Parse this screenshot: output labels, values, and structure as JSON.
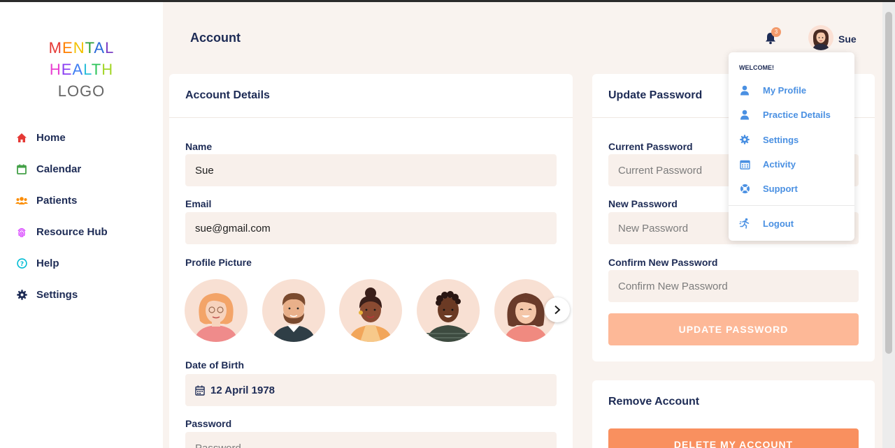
{
  "logo": {
    "line1": "MENTAL",
    "line2": "HEALTH",
    "line3": "LOGO"
  },
  "sidebar": {
    "items": [
      {
        "label": "Home",
        "icon": "home-icon",
        "color": "#e53935"
      },
      {
        "label": "Calendar",
        "icon": "calendar-icon",
        "color": "#43a047"
      },
      {
        "label": "Patients",
        "icon": "users-icon",
        "color": "#fb8c00"
      },
      {
        "label": "Resource Hub",
        "icon": "fingerprint-icon",
        "color": "#d63aff"
      },
      {
        "label": "Help",
        "icon": "help-icon",
        "color": "#00bcd4"
      },
      {
        "label": "Settings",
        "icon": "gear-icon",
        "color": "#1d2b55"
      }
    ]
  },
  "header": {
    "title": "Account",
    "notification_count": "3",
    "user_name": "Sue"
  },
  "account_details": {
    "title": "Account Details",
    "name_label": "Name",
    "name_value": "Sue",
    "email_label": "Email",
    "email_value": "sue@gmail.com",
    "picture_label": "Profile Picture",
    "dob_label": "Date of Birth",
    "dob_value": "12 April 1978",
    "password_label": "Password",
    "password_placeholder": "Password"
  },
  "update_password": {
    "title": "Update Password",
    "current_label": "Current Password",
    "current_placeholder": "Current Password",
    "new_label": "New Password",
    "new_placeholder": "New Password",
    "confirm_label": "Confirm New Password",
    "confirm_placeholder": "Confirm New Password",
    "button": "UPDATE PASSWORD"
  },
  "remove_account": {
    "title": "Remove Account",
    "button": "DELETE MY ACCOUNT"
  },
  "dropdown": {
    "welcome": "WELCOME!",
    "items": [
      {
        "label": "My Profile",
        "icon": "user-icon"
      },
      {
        "label": "Practice Details",
        "icon": "user-icon"
      },
      {
        "label": "Settings",
        "icon": "gear-icon"
      },
      {
        "label": "Activity",
        "icon": "calendar-icon"
      },
      {
        "label": "Support",
        "icon": "lifebuoy-icon"
      },
      {
        "label": "Logout",
        "icon": "runner-icon"
      }
    ]
  },
  "colors": {
    "accent_orange": "#f9a97e",
    "background": "#f9f3ef",
    "field_bg": "#f8f0eb",
    "link_blue": "#4a90e2",
    "navy": "#1d2b55"
  }
}
